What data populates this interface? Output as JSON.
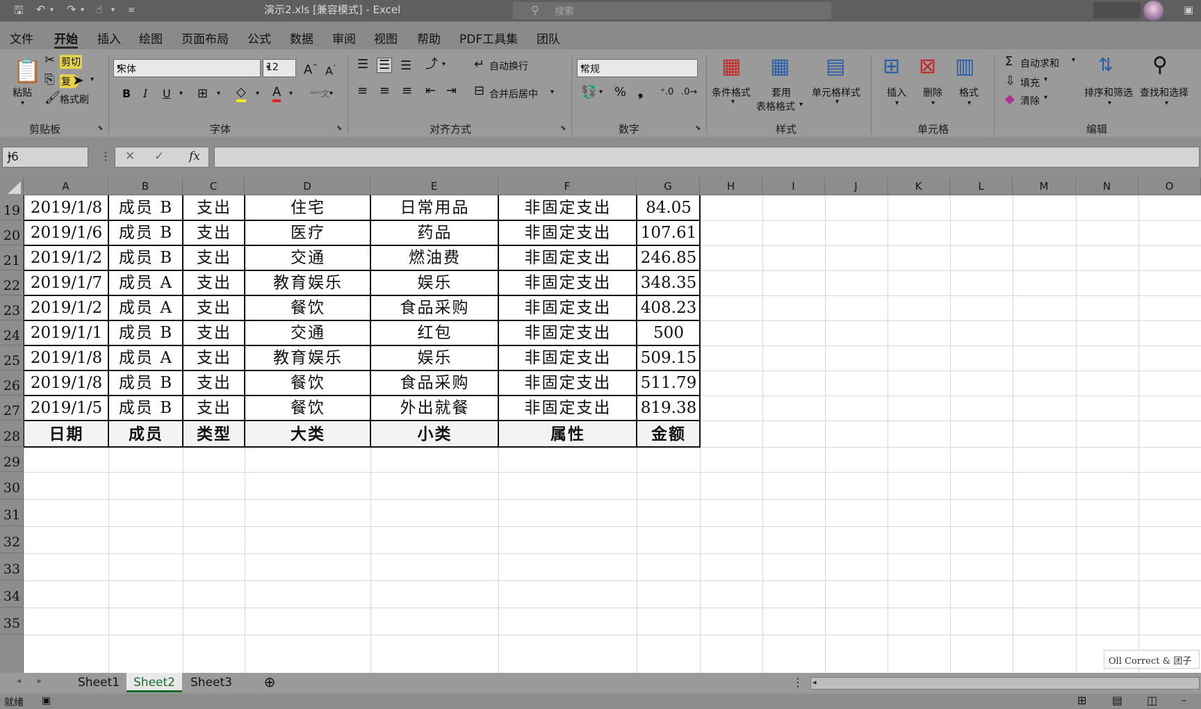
{
  "titlebar": {
    "title": "演示2.xls [兼容模式] - Excel",
    "search_placeholder": "搜索"
  },
  "tabs": [
    "文件",
    "开始",
    "插入",
    "绘图",
    "页面布局",
    "公式",
    "数据",
    "审阅",
    "视图",
    "帮助",
    "PDF工具集",
    "团队"
  ],
  "ribbon": {
    "clipboard": {
      "paste": "粘贴",
      "cut": "剪切",
      "copy": "复",
      "format_painter": "格式刷",
      "group": "剪贴板"
    },
    "font": {
      "name": "宋体",
      "size": "12",
      "bold": "B",
      "italic": "I",
      "underline": "U",
      "group": "字体"
    },
    "alignment": {
      "wrap": "自动换行",
      "merge": "合并后居中",
      "group": "对齐方式"
    },
    "number": {
      "format": "常规",
      "percent": "%",
      "group": "数字"
    },
    "styles": {
      "conditional": "条件格式",
      "table_format_1": "套用",
      "table_format_2": "表格格式",
      "cell_styles": "单元格样式",
      "group": "样式"
    },
    "cells": {
      "insert": "插入",
      "delete": "删除",
      "format": "格式",
      "group": "单元格"
    },
    "editing": {
      "autosum": "自动求和",
      "fill": "填充",
      "clear": "清除",
      "sort": "排序和筛选",
      "find": "查找和选择",
      "group": "编辑"
    }
  },
  "formula_bar": {
    "name_box": "J6",
    "fx": "fx",
    "value": ""
  },
  "columns": [
    "A",
    "B",
    "C",
    "D",
    "E",
    "F",
    "G",
    "H",
    "I",
    "J",
    "K",
    "L",
    "M",
    "N",
    "O"
  ],
  "rows": [
    "19",
    "20",
    "21",
    "22",
    "23",
    "24",
    "25",
    "26",
    "27",
    "28",
    "29",
    "30",
    "31",
    "32",
    "33",
    "34",
    "35"
  ],
  "table": {
    "data": [
      [
        "2019/1/8",
        "成员 B",
        "支出",
        "住宅",
        "日常用品",
        "非固定支出",
        "84.05"
      ],
      [
        "2019/1/6",
        "成员 B",
        "支出",
        "医疗",
        "药品",
        "非固定支出",
        "107.61"
      ],
      [
        "2019/1/2",
        "成员 B",
        "支出",
        "交通",
        "燃油费",
        "非固定支出",
        "246.85"
      ],
      [
        "2019/1/7",
        "成员 A",
        "支出",
        "教育娱乐",
        "娱乐",
        "非固定支出",
        "348.35"
      ],
      [
        "2019/1/2",
        "成员 A",
        "支出",
        "餐饮",
        "食品采购",
        "非固定支出",
        "408.23"
      ],
      [
        "2019/1/1",
        "成员 B",
        "支出",
        "交通",
        "红包",
        "非固定支出",
        "500"
      ],
      [
        "2019/1/8",
        "成员 A",
        "支出",
        "教育娱乐",
        "娱乐",
        "非固定支出",
        "509.15"
      ],
      [
        "2019/1/8",
        "成员 B",
        "支出",
        "餐饮",
        "食品采购",
        "非固定支出",
        "511.79"
      ],
      [
        "2019/1/5",
        "成员 B",
        "支出",
        "餐饮",
        "外出就餐",
        "非固定支出",
        "819.38"
      ]
    ],
    "header": [
      "日期",
      "成员",
      "类型",
      "大类",
      "小类",
      "属性",
      "金额"
    ]
  },
  "watermark": "Oll Correct & 团子",
  "sheet_tabs": [
    "Sheet1",
    "Sheet2",
    "Sheet3"
  ],
  "active_sheet": "Sheet2",
  "status": {
    "ready": "就绪"
  },
  "colors": {
    "title_bg": "#5f5f5f",
    "ribbon_bg": "#9a9a9a",
    "active_tab": "#1a6b2e",
    "grid_line": "#d8d8d8"
  }
}
